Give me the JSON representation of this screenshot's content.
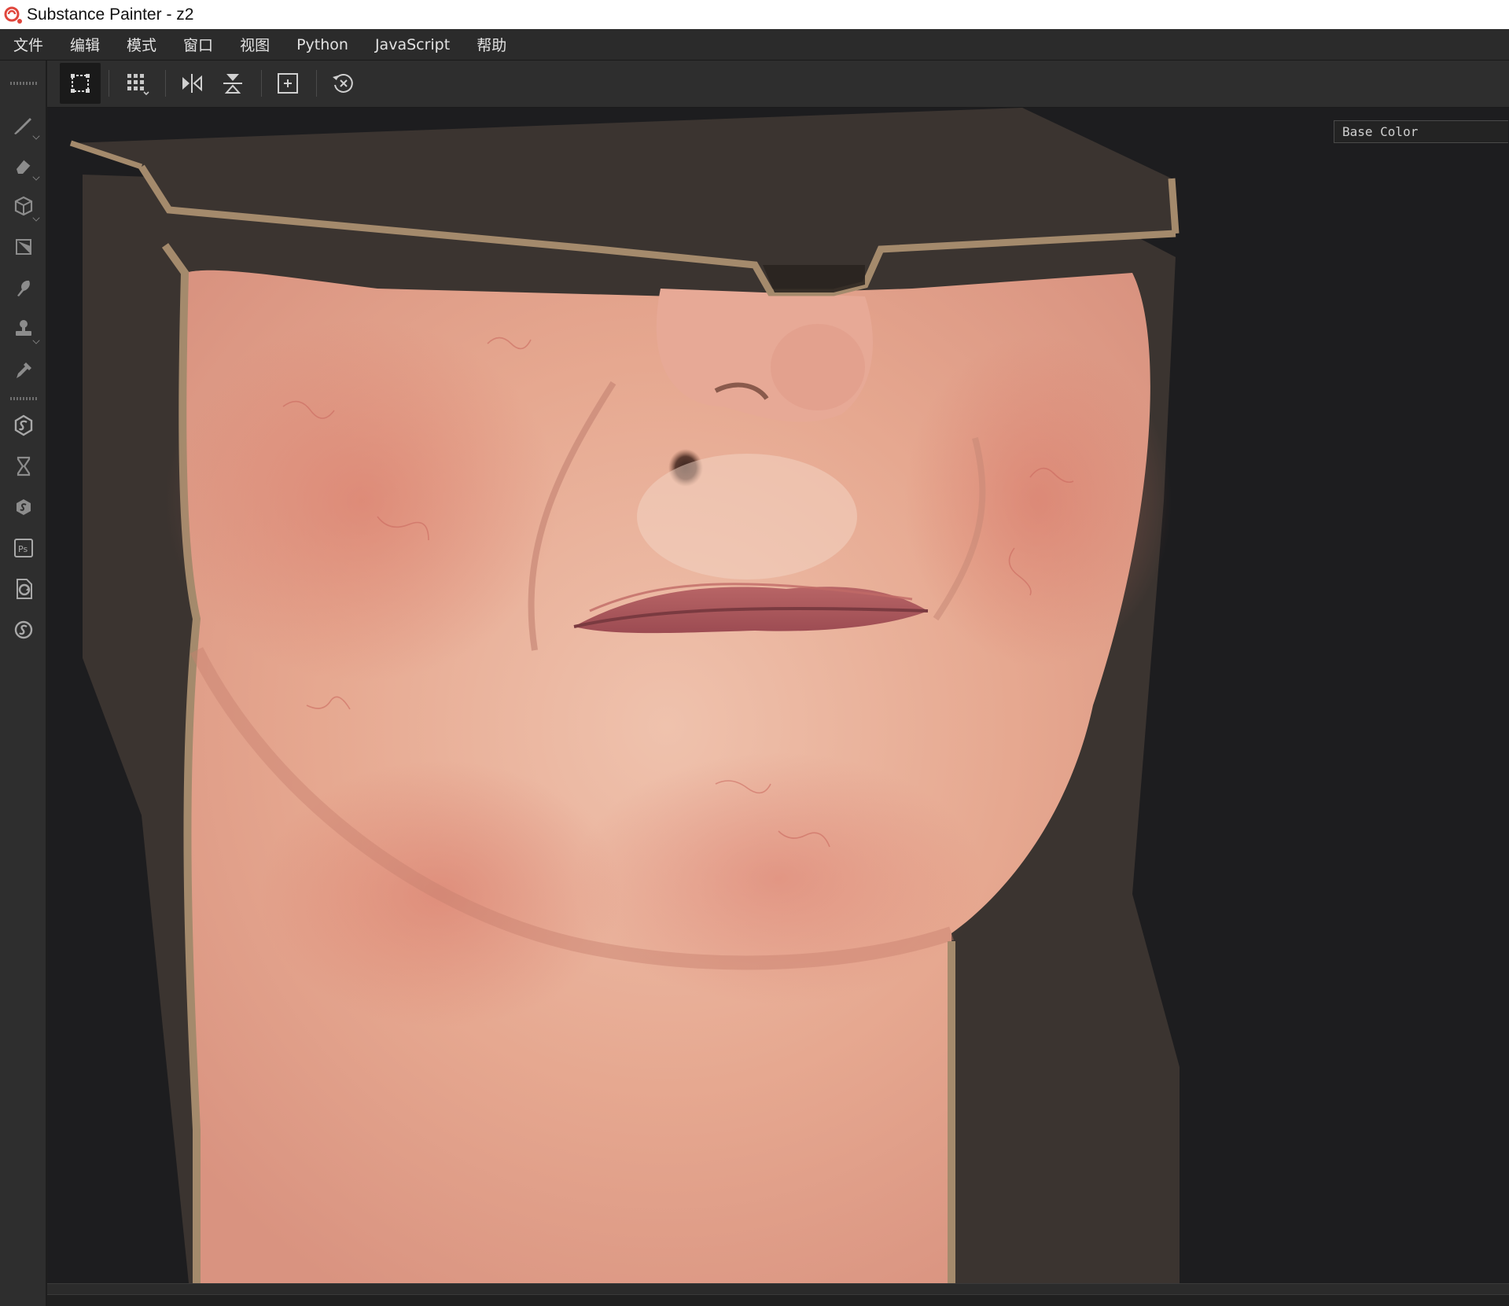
{
  "window": {
    "title": "Substance Painter - z2"
  },
  "menu": [
    {
      "id": "file",
      "label": "文件"
    },
    {
      "id": "edit",
      "label": "编辑"
    },
    {
      "id": "mode",
      "label": "模式"
    },
    {
      "id": "window",
      "label": "窗口"
    },
    {
      "id": "view",
      "label": "视图"
    },
    {
      "id": "python",
      "label": "Python"
    },
    {
      "id": "javascript",
      "label": "JavaScript"
    },
    {
      "id": "help",
      "label": "帮助"
    }
  ],
  "toolbar": {
    "buttons": [
      {
        "icon": "selection-mode-icon",
        "active": true
      },
      {
        "icon": "grid-options-icon",
        "active": false
      },
      {
        "icon": "mirror-horizontal-icon",
        "active": false
      },
      {
        "icon": "mirror-vertical-icon",
        "active": false
      },
      {
        "icon": "focus-frame-icon",
        "active": false
      },
      {
        "icon": "reset-view-icon",
        "active": false
      }
    ]
  },
  "left_tools": [
    {
      "icon": "paint-brush-icon"
    },
    {
      "icon": "eraser-icon"
    },
    {
      "icon": "projection-icon"
    },
    {
      "icon": "polygon-fill-icon"
    },
    {
      "icon": "smudge-icon"
    },
    {
      "icon": "clone-stamp-icon"
    },
    {
      "icon": "color-picker-icon"
    },
    {
      "icon": "substance-source-icon"
    },
    {
      "icon": "hourglass-icon"
    },
    {
      "icon": "substance-share-icon"
    },
    {
      "icon": "photoshop-icon"
    },
    {
      "icon": "sync-icon"
    },
    {
      "icon": "substance-logo-icon"
    }
  ],
  "viewport": {
    "channel": "Base Color"
  },
  "colors": {
    "accent": "#e0463c",
    "panel": "#2e2e2e",
    "viewport_bg": "#1d1d1f",
    "skin": "#e8aa92",
    "cap_dark": "#3b3430",
    "cap_rim": "#a48a6c"
  }
}
